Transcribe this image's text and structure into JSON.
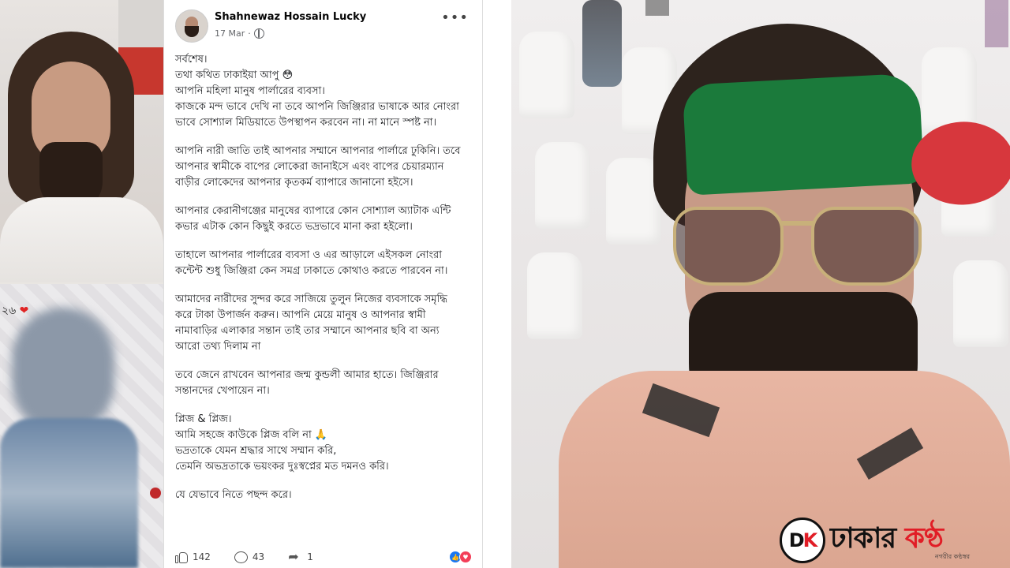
{
  "post": {
    "author": "Shahnewaz Hossain Lucky",
    "date": "17 Mar",
    "more_label": "•••",
    "paragraphs": [
      [
        "সর্বশেষ।",
        "তথা কথিত ঢাকাইয়া আপু 😳",
        "আপনি মহিলা মানুষ পার্লারের ব্যবসা।",
        "কাজকে মন্দ ভাবে দেখি না তবে আপনি জিঞ্জিরার ভাষাকে আর নোংরা",
        "ভাবে সোশ্যাল মিডিয়াতে উপস্থাপন করবেন না। না মানে স্পষ্ট না।"
      ],
      [
        "আপনি নারী জাতি তাই আপনার সম্মানে আপনার পার্লারে ঢুকিনি। তবে",
        "আপনার স্বামীকে বাপের লোকেরা জানাইসে এবং বাপের চেয়ারম্যান",
        "বাড়ীর লোকেদের আপনার কৃতকর্ম ব্যাপারে জানানো হইসে।"
      ],
      [
        "আপনার কেরানীগঞ্জের মানুষের ব্যাপারে কোন সোশ্যাল অ্যাটাক এন্টি",
        "কভার এটাক কোন কিছুই করতে ভদ্রভাবে মানা করা হইলো।"
      ],
      [
        "তাহালে আপনার পার্লারের ব্যবসা ও এর আড়ালে এইসকল নোংরা",
        "কন্টেন্ট শুধু জিঞ্জিরা কেন সমগ্র ঢাকাতে কোথাও করতে পারবেন না।"
      ],
      [
        "আমাদের নারীদের সুন্দর করে সাজিয়ে তুলুন নিজের ব্যবসাকে সমৃদ্ধি",
        "করে টাকা উপার্জন করুন।  আপনি মেয়ে মানুষ ও আপনার স্বামী",
        "নামাবাড়ির এলাকার সন্তান তাই তার সম্মানে আপনার ছবি বা অন্য",
        "আরো তথ্য দিলাম না"
      ],
      [
        "তবে জেনে রাখবেন আপনার জন্ম কুন্ডলী আমার হাতে। জিঞ্জিরার",
        "সন্তানদের খেপায়েন না।"
      ],
      [
        "প্লিজ & প্লিজ।",
        "আমি সহজে কাউকে প্লিজ বলি না 🙏",
        "ভদ্রতাকে যেমন শ্রদ্ধার সাথে সম্মান করি,",
        "তেমনি অভদ্রতাকে ভয়ংকর দুঃস্বপ্নের মত দমনও করি।"
      ],
      [
        "যে যেভাবে নিতে পছন্দ করে।"
      ]
    ],
    "likes": "142",
    "comments": "43",
    "shares": "1"
  },
  "left_photo_caption": "২৬",
  "logo": {
    "mark_d": "D",
    "mark_k": "K",
    "text_main": "ঢাকার ",
    "text_accent": "কণ্ঠ",
    "tagline": "নগরীর কণ্ঠস্বর"
  },
  "colors": {
    "fb_blue": "#1877f2",
    "love_red": "#f33e58",
    "flag_green": "#1b7a3b",
    "flag_red": "#d7373d",
    "logo_red": "#e11d26"
  }
}
